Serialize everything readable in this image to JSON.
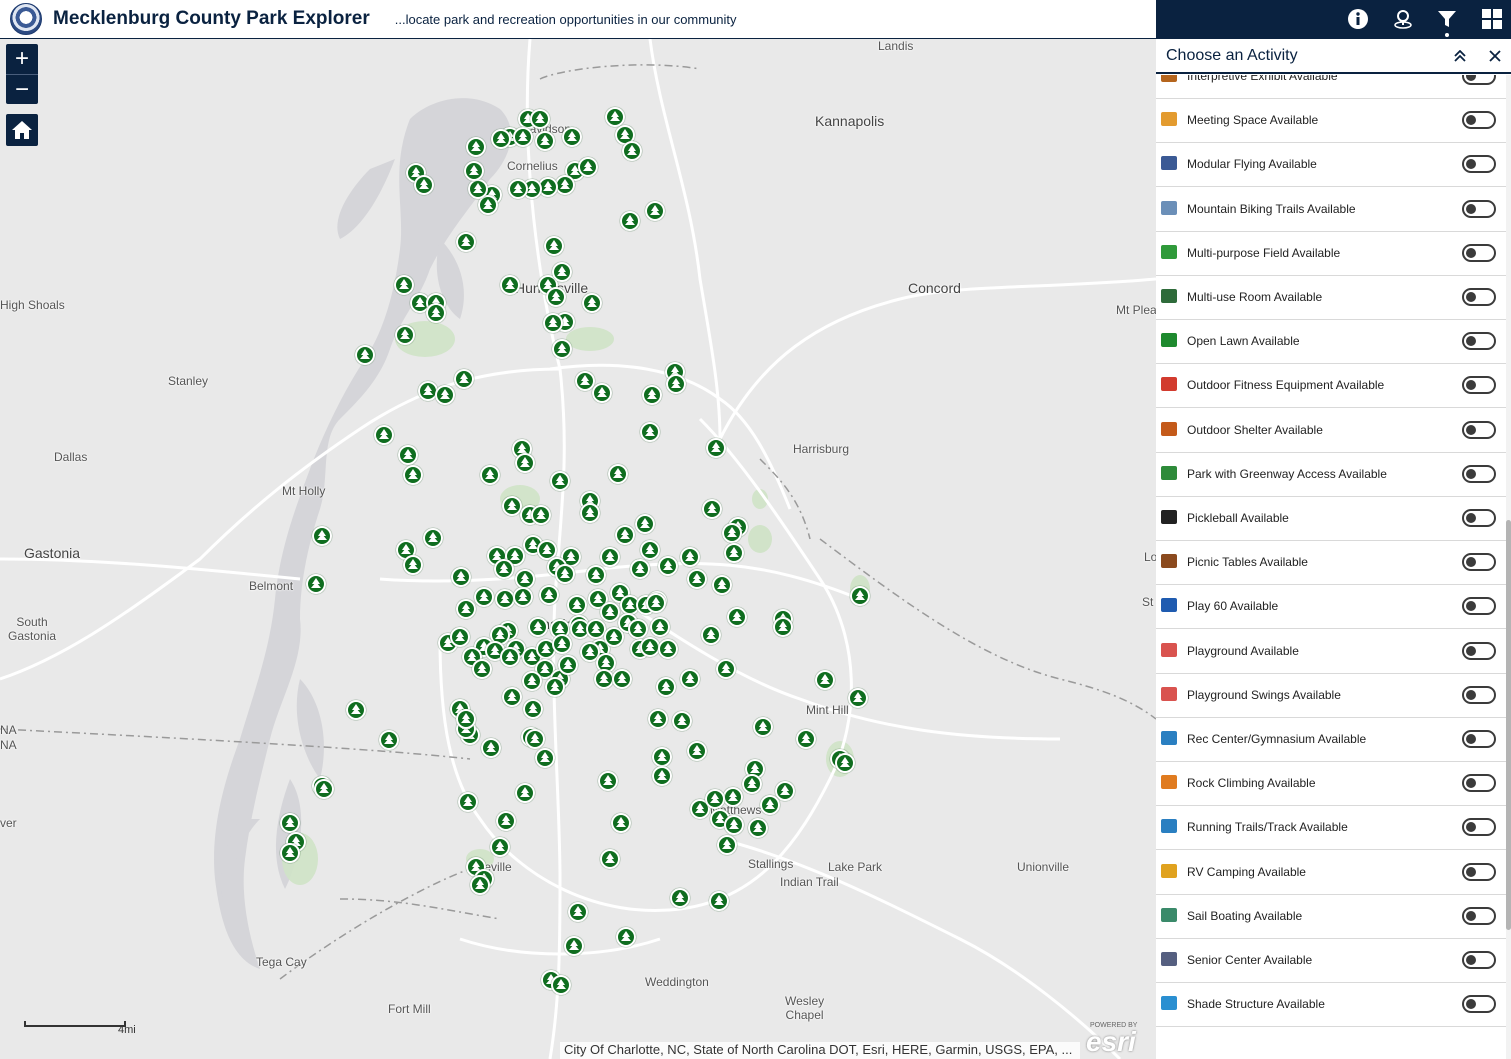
{
  "header": {
    "title": "Mecklenburg County Park Explorer",
    "subtitle": "...locate park and recreation opportunities in our community"
  },
  "toolbar": {
    "buttons": [
      {
        "name": "info-icon",
        "active": false
      },
      {
        "name": "locate-icon",
        "active": false
      },
      {
        "name": "filter-icon",
        "active": true
      },
      {
        "name": "grid-icon",
        "active": false
      }
    ]
  },
  "map": {
    "zoom_in": "+",
    "zoom_out": "−",
    "places": {
      "landis": "Landis",
      "kannapolis": "Kannapolis",
      "davidson": "Davidson",
      "cornelius": "Cornelius",
      "huntersville": "Huntersville",
      "concord": "Concord",
      "high_shoals": "High Shoals",
      "mt_pleasant": "Mt Plea",
      "stanley": "Stanley",
      "dallas": "Dallas",
      "mt_holly": "Mt Holly",
      "harrisburg": "Harrisburg",
      "gastonia": "Gastonia",
      "belmont": "Belmont",
      "south_gastonia": "South\nGastonia",
      "charlotte": "Charlotte",
      "mint_hill": "Mint Hill",
      "matthews": "Matthews",
      "pineville": "Pineville",
      "stallings": "Stallings",
      "lake_park": "Lake Park",
      "indian_trail": "Indian Trail",
      "unionville": "Unionville",
      "tega_cay": "Tega Cay",
      "weddington": "Weddington",
      "fort_mill": "Fort Mill",
      "wesley_chapel": "Wesley\nChapel",
      "na1": "NA",
      "na2": "NA",
      "ver": "ver",
      "lo": "Lo",
      "st": "St"
    },
    "scale_label": "4mi",
    "attribution": "City Of Charlotte, NC, State of North Carolina DOT, Esri, HERE, Garmin, USGS, EPA, ...",
    "esri_powered": "POWERED BY",
    "esri_logo": "esri"
  },
  "panel": {
    "title": "Choose an Activity",
    "activities": [
      {
        "label": "Interpretive Exhibit Available",
        "icon": "exhibit-icon",
        "color": "#b5651d",
        "enabled": false
      },
      {
        "label": "Meeting Space Available",
        "icon": "handshake-icon",
        "color": "#e39b2f",
        "enabled": false
      },
      {
        "label": "Modular Flying Available",
        "icon": "plane-icon",
        "color": "#3b5a95",
        "enabled": false
      },
      {
        "label": "Mountain Biking Trails Available",
        "icon": "mountain-bike-icon",
        "color": "#6b8fb8",
        "enabled": false
      },
      {
        "label": "Multi-purpose Field Available",
        "icon": "field-icon",
        "color": "#2f9a3a",
        "enabled": false
      },
      {
        "label": "Multi-use Room Available",
        "icon": "room-icon",
        "color": "#2e6b3a",
        "enabled": false
      },
      {
        "label": "Open Lawn Available",
        "icon": "lawn-icon",
        "color": "#1e8a2e",
        "enabled": false
      },
      {
        "label": "Outdoor Fitness Equipment Available",
        "icon": "dumbbell-icon",
        "color": "#d23b2e",
        "enabled": false
      },
      {
        "label": "Outdoor Shelter Available",
        "icon": "shelter-icon",
        "color": "#c45a1a",
        "enabled": false
      },
      {
        "label": "Park with Greenway Access Available",
        "icon": "tree-icon",
        "color": "#2e8b3a",
        "enabled": false
      },
      {
        "label": "Pickleball Available",
        "icon": "paddle-icon",
        "color": "#222222",
        "enabled": false
      },
      {
        "label": "Picnic Tables Available",
        "icon": "picnic-table-icon",
        "color": "#8b4a1e",
        "enabled": false
      },
      {
        "label": "Play 60 Available",
        "icon": "play60-icon",
        "color": "#1f5bb0",
        "enabled": false
      },
      {
        "label": "Playground Available",
        "icon": "playground-icon",
        "color": "#d9534f",
        "enabled": false
      },
      {
        "label": "Playground Swings Available",
        "icon": "swing-icon",
        "color": "#d9534f",
        "enabled": false
      },
      {
        "label": "Rec Center/Gymnasium Available",
        "icon": "gym-icon",
        "color": "#2a7fc1",
        "enabled": false
      },
      {
        "label": "Rock Climbing Available",
        "icon": "climbing-icon",
        "color": "#e07b1f",
        "enabled": false
      },
      {
        "label": "Running Trails/Track Available",
        "icon": "runner-icon",
        "color": "#2a7fc1",
        "enabled": false
      },
      {
        "label": "RV Camping Available",
        "icon": "rv-icon",
        "color": "#e0a21f",
        "enabled": false
      },
      {
        "label": "Sail Boating Available",
        "icon": "sailboat-icon",
        "color": "#3a8a6a",
        "enabled": false
      },
      {
        "label": "Senior Center Available",
        "icon": "senior-center-icon",
        "color": "#555f80",
        "enabled": false
      },
      {
        "label": "Shade Structure Available",
        "icon": "shade-icon",
        "color": "#2a8fd1",
        "enabled": false
      }
    ]
  },
  "colors": {
    "navy": "#0a2240",
    "park_green": "#0f6d1f"
  }
}
